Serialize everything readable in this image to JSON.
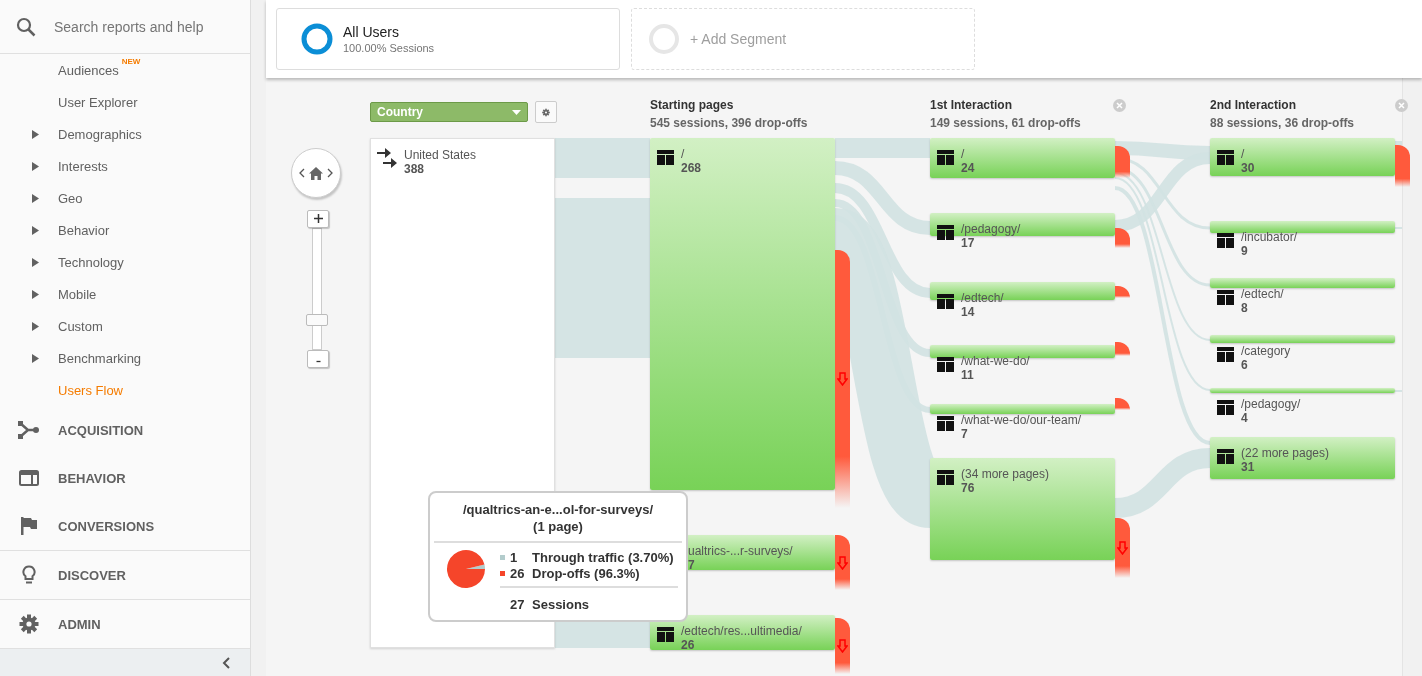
{
  "sidebar": {
    "search": {
      "placeholder": "Search reports and help"
    },
    "items": [
      {
        "label": "Audiences",
        "badge": "NEW",
        "expandable": false,
        "selected": false
      },
      {
        "label": "User Explorer",
        "expandable": false,
        "selected": false
      },
      {
        "label": "Demographics",
        "expandable": true,
        "selected": false
      },
      {
        "label": "Interests",
        "expandable": true,
        "selected": false
      },
      {
        "label": "Geo",
        "expandable": true,
        "selected": false
      },
      {
        "label": "Behavior",
        "expandable": true,
        "selected": false
      },
      {
        "label": "Technology",
        "expandable": true,
        "selected": false
      },
      {
        "label": "Mobile",
        "expandable": true,
        "selected": false
      },
      {
        "label": "Custom",
        "expandable": true,
        "selected": false
      },
      {
        "label": "Benchmarking",
        "expandable": true,
        "selected": false
      },
      {
        "label": "Users Flow",
        "expandable": false,
        "selected": true
      }
    ],
    "sections": [
      {
        "label": "ACQUISITION"
      },
      {
        "label": "BEHAVIOR"
      },
      {
        "label": "CONVERSIONS"
      },
      {
        "label": "DISCOVER"
      },
      {
        "label": "ADMIN"
      }
    ]
  },
  "segments": [
    {
      "kind": "segment",
      "label": "All Users",
      "detail": "100.00% Sessions"
    },
    {
      "kind": "add",
      "label": "+ Add Segment"
    }
  ],
  "flow": {
    "dimension": {
      "value": "Country"
    },
    "zoom": {
      "level": 0.22
    },
    "source_nodes": [
      {
        "label": "United States",
        "count": "388"
      }
    ],
    "columns": [
      {
        "title": "Starting pages",
        "summary": "545 sessions, 396 drop-offs",
        "closable": false,
        "nodes": [
          {
            "label": "/",
            "count": "268"
          },
          {
            "label": "ualtrics-...r-surveys/",
            "count": "7"
          },
          {
            "label": "/edtech/res...ultimedia/",
            "count": "26"
          }
        ]
      },
      {
        "title": "1st Interaction",
        "summary": "149 sessions, 61 drop-offs",
        "closable": true,
        "nodes": [
          {
            "label": "/",
            "count": "24"
          },
          {
            "label": "/pedagogy/",
            "count": "17"
          },
          {
            "label": "/edtech/",
            "count": "14"
          },
          {
            "label": "/what-we-do/",
            "count": "11"
          },
          {
            "label": "/what-we-do/our-team/",
            "count": "7"
          },
          {
            "label": "(34 more pages)",
            "count": "76"
          }
        ]
      },
      {
        "title": "2nd Interaction",
        "summary": "88 sessions, 36 drop-offs",
        "closable": true,
        "nodes": [
          {
            "label": "/",
            "count": "30"
          },
          {
            "label": "/incubator/",
            "count": "9"
          },
          {
            "label": "/edtech/",
            "count": "8"
          },
          {
            "label": "/category",
            "count": "6"
          },
          {
            "label": "/pedagogy/",
            "count": "4"
          },
          {
            "label": "(22 more pages)",
            "count": "31"
          }
        ]
      }
    ],
    "tooltip": {
      "title": "/qualtrics-an-e...ol-for-surveys/",
      "subtitle": "(1 page)",
      "rows": [
        {
          "count": "1",
          "label": "Through traffic (3.70%)",
          "color": "#b3cccc"
        },
        {
          "count": "26",
          "label": "Drop-offs (96.3%)",
          "color": "#f5452a"
        }
      ],
      "total": {
        "count": "27",
        "label": "Sessions"
      }
    }
  }
}
